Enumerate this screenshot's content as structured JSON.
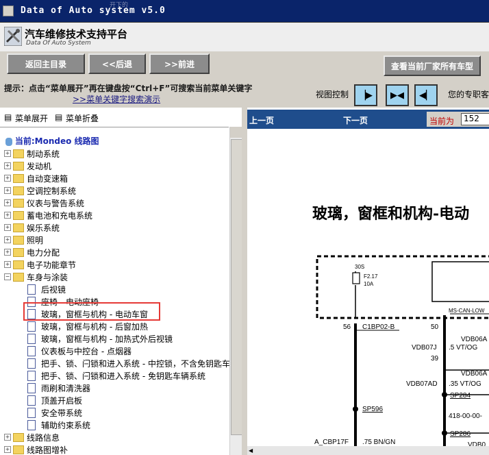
{
  "window": {
    "title": "Data of Auto system v5.0",
    "top_overlay": "开下的"
  },
  "header": {
    "title": "汽车维修技术支持平台",
    "subtitle": "Data Of Auto System"
  },
  "toolbar": {
    "home": "返回主目录",
    "back": "<<后退",
    "forward": ">>前进",
    "all_models": "查看当前厂家所有车型"
  },
  "hint": {
    "line1": "提示：点击“菜单展开”再在键盘按“Ctrl+F”可搜索当前菜单关键字",
    "line2": ">>菜单关键字搜索演示",
    "view_control": "视图控制",
    "right_text": "您的专职客"
  },
  "menu": {
    "expand": "菜单展开",
    "collapse": "菜单折叠"
  },
  "current": "当前:Mondeo 线路图",
  "tree": {
    "top_folders": [
      "制动系统",
      "发动机",
      "自动变速箱",
      "空调控制系统",
      "仪表与警告系统",
      "蓄电池和充电系统",
      "娱乐系统",
      "照明",
      "电力分配",
      "电子功能章节"
    ],
    "open_folder": "车身与涂装",
    "children": [
      "后视镜",
      "座椅 - 电动座椅",
      "玻璃，窗框与机构 - 电动车窗",
      "玻璃，窗框与机构 - 后窗加热",
      "玻璃，窗框与机构 - 加热式外后视镜",
      "仪表板与中控台 - 点烟器",
      "把手、锁、闩锁和进入系统 - 中控锁，不含免钥匙车",
      "把手、锁、闩锁和进入系统 - 免钥匙车辆系统",
      "雨刷和清洗器",
      "顶盖开启板",
      "安全带系统",
      "辅助约束系统"
    ],
    "bottom_folders": [
      "线路信息",
      "线路图增补"
    ]
  },
  "viewer": {
    "prev": "上一页",
    "next": "下一页",
    "page_label": "当前为",
    "page_value": "152",
    "diagram_title": "玻璃，窗框和机构-电动",
    "labels": {
      "l_30s": "30S",
      "fuse": "F2.17",
      "fuse_amp": "10A",
      "n56": "56",
      "c1bp": "C1BP02-B",
      "n50": "50",
      "vdb06a": "VDB06A",
      "vt_og": ".5 VT/OG",
      "vdb07j": "VDB07J",
      "n39": "39",
      "vdb06a2": "VDB06A",
      "vdb07ad": "VDB07AD",
      "vt_og2": ".35 VT/OG",
      "sp284": "SP284",
      "sp596": "SP596",
      "n418": "418-00-00-",
      "sp286": "SP286",
      "acbp": "A_CBP17F",
      "bngn": ".75 BN/GN",
      "vdb0": "VDB0",
      "mscan": "MS-CAN-LOW"
    }
  },
  "colors": {
    "titlebar": "#0a246a",
    "navbar": "#1f4d8c",
    "highlight_box": "#e53935",
    "current_text": "#1a2ab0"
  }
}
